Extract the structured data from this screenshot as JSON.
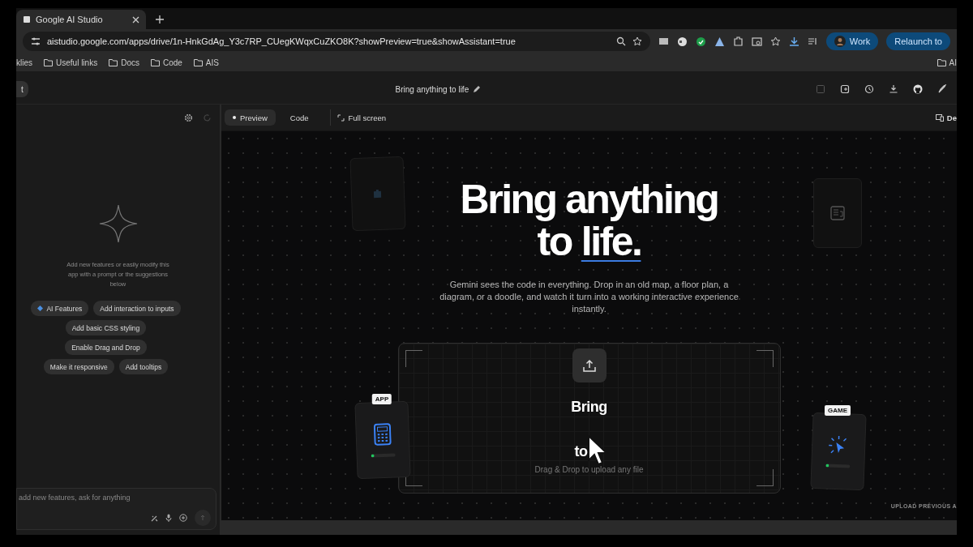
{
  "browser": {
    "tab": {
      "title": "Google AI Studio"
    },
    "url": "aistudio.google.com/apps/drive/1n-HnkGdAg_Y3c7RP_CUegKWqxCuZKO8K?showPreview=true&showAssistant=true",
    "profile": "Work",
    "relaunch": "Relaunch to",
    "bookmarks": [
      "klies",
      "Useful links",
      "Docs",
      "Code",
      "AIS"
    ],
    "bookmark_right": "AI"
  },
  "header": {
    "back": "t",
    "title": "Bring anything to life"
  },
  "toolbar": {
    "tabs": [
      {
        "label": "Preview",
        "selected": true
      },
      {
        "label": "Code",
        "selected": false
      }
    ],
    "fullscreen": "Full screen",
    "device": "De"
  },
  "assistant": {
    "hint": "Add new features or easily modify this app with a prompt or the suggestions below",
    "suggestion_rows": [
      [
        {
          "label": "AI Features",
          "kind": "ai"
        },
        {
          "label": "Add interaction to inputs",
          "kind": "plain"
        }
      ],
      [
        {
          "label": "Add basic CSS styling",
          "kind": "plain"
        }
      ],
      [
        {
          "label": "Enable Drag and Drop",
          "kind": "plain"
        }
      ],
      [
        {
          "label": "Make it responsive",
          "kind": "plain"
        },
        {
          "label": "Add tooltips",
          "kind": "plain"
        }
      ]
    ],
    "placeholder": "add new features, ask for anything"
  },
  "preview": {
    "headline_top": "Bring anything",
    "headline_to": "to",
    "headline_life": "life.",
    "description": "Gemini sees the code in everything. Drop in an old map, a floor plan, a diagram, or a doodle, and watch it turn into a working interactive experience instantly.",
    "drop": {
      "title": "Bring",
      "subtitle": "to",
      "hint": "Drag & Drop to upload any file"
    },
    "cards": [
      {
        "label": "APP",
        "kind": "app"
      },
      {
        "label": "GAME",
        "kind": "game"
      }
    ],
    "footer": "UPLOAD PREVIOUS A"
  }
}
